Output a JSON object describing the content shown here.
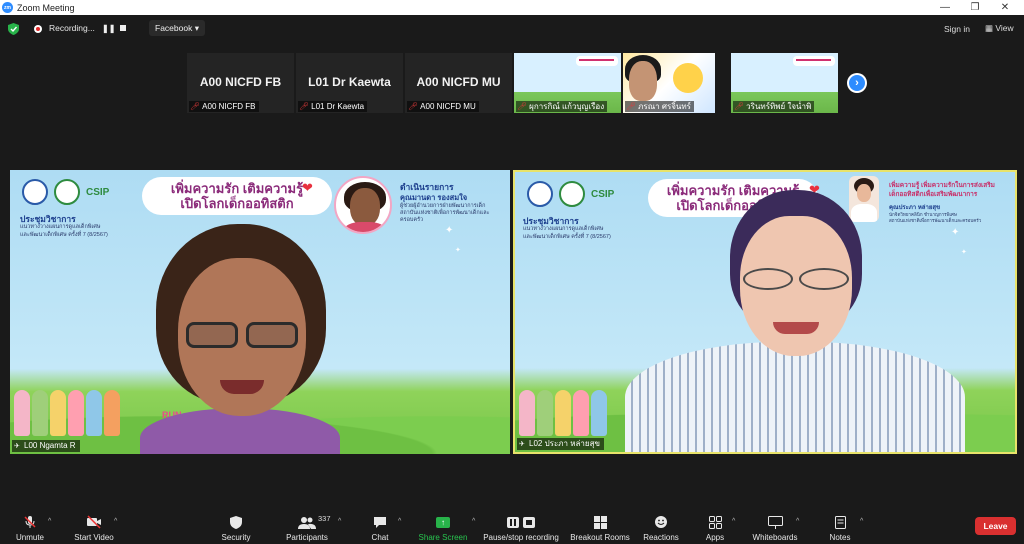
{
  "window": {
    "title": "Zoom Meeting",
    "controls": [
      "—",
      "❐",
      "✕"
    ]
  },
  "topbar": {
    "recording_label": "Recording...",
    "stream_selector": "Facebook ▾",
    "signin_label": "Sign in",
    "view_label": "View"
  },
  "thumbnails": [
    {
      "big": "A00 NICFD FB",
      "label": "A00 NICFD FB"
    },
    {
      "big": "L01 Dr Kaewta",
      "label": "L01 Dr Kaewta"
    },
    {
      "big": "A00 NICFD MU",
      "label": "A00 NICFD MU"
    },
    {
      "big": "",
      "label": "ผุการกิณ์ แก้วบุญเรือง"
    },
    {
      "big": "",
      "label": "ภรณา ศรจิ้นทร์"
    },
    {
      "big": "",
      "label": "วรินทร์ทิพย์ ใจน่ำพิ"
    }
  ],
  "tiles": {
    "left": {
      "headline_1": "เพิ่มความรัก เติมความรู้",
      "headline_2": "เปิดโลกเด็กออทิสติก",
      "meeting": "ประชุมวิชาการ",
      "meeting_sub_1": "แนวทางวางแผนการดูแลเด็กพิเศษ",
      "meeting_sub_2": "และพัฒนาเด็กพิเศษ ครั้งที่ 7 (8/2567)",
      "host_title": "ดำเนินรายการ",
      "host_name": "คุณมานดา รองสมใจ",
      "host_sub_1": "ผู้ช่วยผู้อำนวยการฝ่ายพัฒนาการเด็ก",
      "host_sub_2": "สถาบันแห่งชาติเพื่อการพัฒนาเด็กและครอบครัว",
      "run_text": "RUN",
      "name": "L00 Ngamta R"
    },
    "right": {
      "headline_1": "เพิ่มความรัก เติมความรู้",
      "headline_2": "เปิดโลกเด็กออทิสติก",
      "meeting": "ประชุมวิชาการ",
      "meeting_sub_1": "แนวทางวางแผนการดูแลเด็กพิเศษ",
      "meeting_sub_2": "และพัฒนาเด็กพิเศษ ครั้งที่ 7 (8/2567)",
      "host_title": "เพิ่มความรู้ เพิ่มความรักในการส่งเสริม",
      "host_title_2": "เด็กออทิสติกเพื่อเสริมพัฒนาการ",
      "host_name": "คุณประภา หล่ายสุข",
      "host_sub_1": "นักจิตวิทยาคลินิก ชำนาญการพิเศษ",
      "host_sub_2": "สถาบันแห่งชาติเพื่อการพัฒนาเด็กและครอบครัว",
      "name": "L02 ประภา หล่ายสุข"
    }
  },
  "toolbar": {
    "unmute": "Unmute",
    "start_video": "Start Video",
    "security": "Security",
    "participants": "Participants",
    "participants_count": "337",
    "chat": "Chat",
    "share_screen": "Share Screen",
    "pause_recording": "Pause/stop recording",
    "breakout_rooms": "Breakout Rooms",
    "reactions": "Reactions",
    "apps": "Apps",
    "whiteboards": "Whiteboards",
    "notes": "Notes",
    "leave": "Leave"
  },
  "colors": {
    "accent": "#2d8cff",
    "leave": "#d93030",
    "share": "#28b34a",
    "active_speaker_border": "#e8e36a"
  }
}
